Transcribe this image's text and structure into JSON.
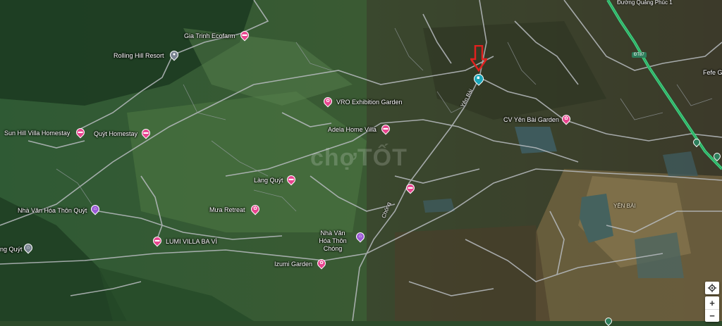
{
  "map": {
    "watermark": "chợTỐT",
    "roads": {
      "duong_quang_phuc": "Đường Quảng Phúc 1",
      "dt87": "ĐT87",
      "yen_bai_road": "Yên Bài",
      "chong_road": "Chóng"
    },
    "areas": {
      "yen_bai": "YÊN BÀI",
      "fefe": "Fefe G"
    },
    "places": [
      {
        "id": "gia-trinh",
        "label": "Gia Trinh Ecofarm",
        "type": "hotel",
        "color": "#e8458f"
      },
      {
        "id": "rolling-hill",
        "label": "Rolling Hill Resort",
        "type": "generic",
        "color": "#7a8491"
      },
      {
        "id": "vro",
        "label": "VRO Exhibition Garden",
        "type": "garden",
        "color": "#e8458f"
      },
      {
        "id": "adela",
        "label": "Adela Home Villa",
        "type": "hotel",
        "color": "#e8458f"
      },
      {
        "id": "cv-yen-bai",
        "label": "CV Yên Bài Garden",
        "type": "garden",
        "color": "#e8458f"
      },
      {
        "id": "sun-hill",
        "label": "Sun Hill Villa Homestay",
        "type": "hotel",
        "color": "#e8458f"
      },
      {
        "id": "quyt-homestay",
        "label": "Quýt Homestay",
        "type": "hotel",
        "color": "#e8458f"
      },
      {
        "id": "lang-quyt",
        "label": "Làng Quýt",
        "type": "hotel",
        "color": "#e8458f"
      },
      {
        "id": "mua-retreat",
        "label": "Mưa Retreat",
        "type": "garden",
        "color": "#e8458f"
      },
      {
        "id": "nha-van-hoa-quyt",
        "label": "Nhà Văn Hóa Thôn Quýt",
        "type": "culture",
        "color": "#9c5ad6"
      },
      {
        "id": "lumi",
        "label": "LUMI VILLA BA VÌ",
        "type": "hotel",
        "color": "#e8458f"
      },
      {
        "id": "lang-quyt-2",
        "label": "ng Quýt",
        "type": "museum",
        "color": "#7a8491"
      },
      {
        "id": "nha-van-hoa-chong",
        "label": "Nhà Văn Hóa Thôn Chóng",
        "type": "culture",
        "color": "#9c5ad6"
      },
      {
        "id": "izumi",
        "label": "Izumi Garden",
        "type": "garden",
        "color": "#e8458f"
      },
      {
        "id": "unnamed-hotel",
        "label": "",
        "type": "hotel",
        "color": "#e8458f"
      },
      {
        "id": "selected",
        "label": "",
        "type": "selected",
        "color": "#1aa5b8"
      }
    ],
    "marker_color": "#e0211f",
    "highway_color": "#3fcf7f"
  },
  "controls": {
    "locate_icon": "crosshair-icon",
    "zoom_in": "+",
    "zoom_out": "−"
  }
}
